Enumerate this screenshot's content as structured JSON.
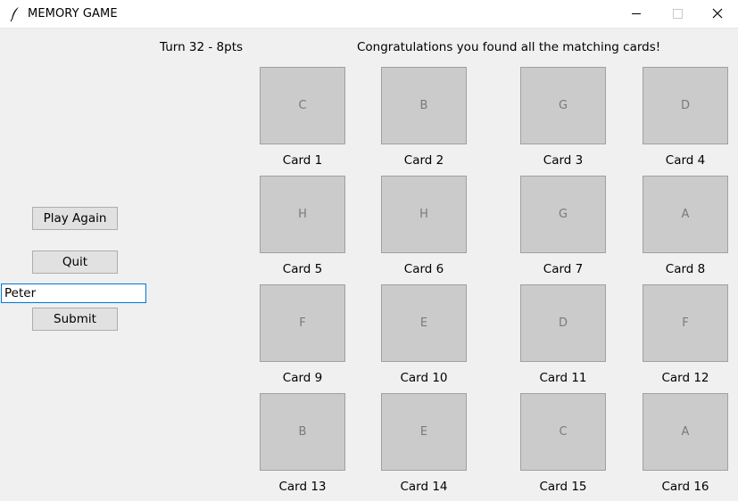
{
  "window": {
    "title": "MEMORY GAME"
  },
  "status": {
    "turn": "Turn 32 - 8pts",
    "message": "Congratulations you found all the matching cards!"
  },
  "controls": {
    "play_again": "Play Again",
    "quit": "Quit",
    "name_value": "Peter",
    "submit": "Submit"
  },
  "cards": [
    {
      "face": "C",
      "label": "Card 1"
    },
    {
      "face": "B",
      "label": "Card 2"
    },
    {
      "face": "G",
      "label": "Card 3"
    },
    {
      "face": "D",
      "label": "Card 4"
    },
    {
      "face": "H",
      "label": "Card 5"
    },
    {
      "face": "H",
      "label": "Card 6"
    },
    {
      "face": "G",
      "label": "Card 7"
    },
    {
      "face": "A",
      "label": "Card 8"
    },
    {
      "face": "F",
      "label": "Card 9"
    },
    {
      "face": "E",
      "label": "Card 10"
    },
    {
      "face": "D",
      "label": "Card 11"
    },
    {
      "face": "F",
      "label": "Card 12"
    },
    {
      "face": "B",
      "label": "Card 13"
    },
    {
      "face": "E",
      "label": "Card 14"
    },
    {
      "face": "C",
      "label": "Card 15"
    },
    {
      "face": "A",
      "label": "Card 16"
    }
  ]
}
